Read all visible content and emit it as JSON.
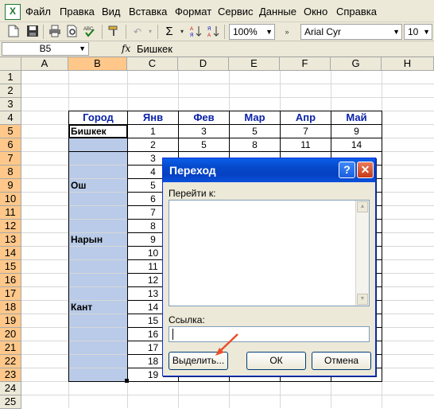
{
  "menubar": {
    "items": [
      "Файл",
      "Правка",
      "Вид",
      "Вставка",
      "Формат",
      "Сервис",
      "Данные",
      "Окно",
      "Справка"
    ]
  },
  "toolbar": {
    "zoom": "100%",
    "font": "Arial Cyr",
    "font_size": "10",
    "icons": [
      "new-doc-icon",
      "save-icon",
      "print-icon",
      "print-preview-icon",
      "spellcheck-icon",
      "format-painter-icon",
      "undo-icon",
      "autosum-icon",
      "sort-ascending-icon",
      "sort-descending-icon",
      "chart-icon"
    ]
  },
  "formula_bar": {
    "name_box": "B5",
    "fx": "fx",
    "content": "Бишкек"
  },
  "grid": {
    "columns": [
      "A",
      "B",
      "C",
      "D",
      "E",
      "F",
      "G",
      "H"
    ],
    "rows": [
      "1",
      "2",
      "3",
      "4",
      "5",
      "6",
      "7",
      "8",
      "9",
      "10",
      "11",
      "12",
      "13",
      "14",
      "15",
      "16",
      "17",
      "18",
      "19",
      "20",
      "21",
      "22",
      "23",
      "24",
      "25"
    ],
    "table_headers": [
      "Город",
      "Янв",
      "Фев",
      "Мар",
      "Апр",
      "Май"
    ],
    "cities": {
      "r5": "Бишкек",
      "r9": "Ош",
      "r13": "Нарын",
      "r18": "Кант"
    },
    "col_c": [
      "1",
      "2",
      "3",
      "4",
      "5",
      "6",
      "7",
      "8",
      "9",
      "10",
      "11",
      "12",
      "13",
      "14",
      "15",
      "16",
      "17",
      "18",
      "19"
    ],
    "row5": [
      "1",
      "3",
      "5",
      "7",
      "9"
    ],
    "row6": [
      "2",
      "5",
      "8",
      "11",
      "14"
    ]
  },
  "dialog": {
    "title": "Переход",
    "goto_label": "Перейти к:",
    "ref_label": "Ссылка:",
    "ref_value": "",
    "select_button": "Выделить...",
    "ok_button": "ОК",
    "cancel_button": "Отмена",
    "help_glyph": "?",
    "close_glyph": "✕"
  },
  "colors": {
    "header_text": "#0b22a8",
    "selection": "#b9cbe8",
    "selected_header": "#ffc88a",
    "annotation_arrow": "#e8502a"
  }
}
